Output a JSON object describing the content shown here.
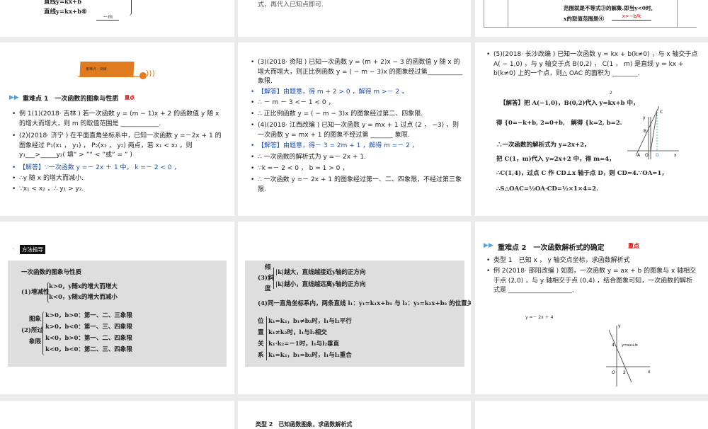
{
  "slides": {
    "s0a": {
      "line1": "直线y=kx+b",
      "line2": "直线y=kx+b⑥",
      "blank": "－m"
    },
    "s0b": {
      "text": "式，再代入已知点即可."
    },
    "s0c": {
      "line1": "范围就是不等式③的解集.即当y<0时,",
      "line2": "x的取值范围是④",
      "answer": "x>−b/k"
    },
    "s1": {
      "banner": "重难点 · 突破",
      "title": "重难点 1　一次函数的图象与性质",
      "tag": "重点",
      "bullets": [
        "例 1(1)(2018· 吉林 ) 若一次函数 y = (m − 1)x + 2 的函数值 y 随 x 的增大而增大，则 m 的取值范围是 ____________.",
        "(2)(2018· 济宁 ) 在平面直角坐标系中，已知一次函数 y =－2x + 1 的图象经过 P₁(x₁ ， y₁) ， P₂(x₂ ， y₂) 两点，若 x₁ < x₂ ，则 y₁___>_____y₂( 填“ > ”“ < ”或“ = ” )",
        "【解答】∵一次函数 y =－ 2x ＋ 1 中， k =－ 2 < 0 ，",
        "∴y 随 x 的增大而减小.",
        "∵x₁ < x₂ ，∴ y₁ > y₂."
      ]
    },
    "s2": {
      "bullets": [
        "(3)(2018· 资阳 ) 已知一次函数 y = (m + 2)x − 3 的函数值 y 随 x 的增大而增大，则正比例函数 y = ( − m − 3)x 的图象经过第___________ 象限.",
        "【解答】由题意，得 m + 2 > 0 ，解得 m >－ 2 ，",
        "∴ － m － 3 <－ 1 < 0 ，",
        "∴ 正比例函数 y = ( − m − 3)x 的图象经过第二、四象限.",
        "(4)(2018· 江西改编 ) 已知一次函数 y = mx + 1 过点 (2 ， −3) ，则一次函数 y = mx + 1 的图象不经过第 _______ 象限.",
        "【解答】由题意，得－ 3 = 2m + 1 ，解得 m =－ 2 ，",
        "∴ 一次函数的解析式为 y =－ 2x + 1.",
        "∵k =－ 2 < 0 ， b = 1 > 0 ，",
        "∴ 一次函数 y =－ 2x + 1 的图象经过第一、二、四象限，不经过第三象限."
      ]
    },
    "s3": {
      "bullet": "(5)(2018· 长沙改编 ) 已知一次函数 y = kx + b(k≠0) ，与 x 轴交于点 A( − 1,0) ，与 y 轴交于点 B(0,2) ， C(1 ， m) 是直线 y = kx + b(k≠0) 上的一个点，则△ OAC 的面积为 ________.",
      "answer": "2",
      "lines": [
        "【解答】把 A(−1,0)，B(0,2)代入 y=kx+b 中，",
        "得 {0=−k+b, 2=0+b,　解得 {k=2, b=2.",
        "∴一次函数的解析式为 y=2x+2，",
        "把 C(1，m)代入 y=2x+2 中，得 m=4，",
        "∴C(1,4)，过点 C 作 CD⊥x 轴于点 D，则 CD=4.∵OA=1，",
        "∴S△OAC=½OA·CD=½×1×4=2."
      ],
      "labels": {
        "y": "y",
        "x": "x",
        "A": "A",
        "O": "O",
        "D": "D",
        "B": "B",
        "C": "C"
      }
    },
    "s4": {
      "badge": "方法指导",
      "title": "一次函数的图象与性质",
      "p1_label": "(1)增减性",
      "p1": [
        "k>0，y随x的增大而增大",
        "k<0，y随x的增大而减小"
      ],
      "p2_label": [
        "图象",
        "(2)所过",
        "象限"
      ],
      "p2": [
        "k>0，b>0：第一、二、三象限",
        "k>0，b<0：第一、三、四象限",
        "k<0，b>0：第一、二、四象限",
        "k<0，b<0：第二、三、四象限"
      ]
    },
    "s5": {
      "p3_label": [
        "倾",
        "(3)斜",
        "度"
      ],
      "p3": [
        "|k|越大，直线越接近y轴的正方向",
        "|k|越小，直线越远离y轴的正方向"
      ],
      "p4": "(4)同一直角坐标系内，两条直线 l₁：y₁=k₁x+b₁ 与 l₂：y₂=k₂x+b₂ 的位置关系：",
      "p4_label": [
        "位",
        "置",
        "关",
        "系"
      ],
      "p4_items": [
        "k₁=k₂，b₁≠b₂时，l₁与l₂平行",
        "k₁≠k₂时，l₁与l₂相交",
        "k₁·k₂=－1时，l₁与l₂垂直",
        "k₁=k₂，b₁=b₂时，l₁与l₂重合"
      ]
    },
    "s6": {
      "title": "重难点 2　一次函数解析式的确定",
      "tag": "重点",
      "bullets": [
        "类型 1　已知 x ， y 轴交点坐标，求函数解析式",
        "例 2(2018· 邵阳改编 ) 如图，一次函数 y = ax + b 的图象与 x 轴相交于点 (2,0) ，与 y 轴相交于点 (0,4) ，结合图象可知，一次函数的解析式是 ____________________."
      ],
      "answer": "y =－ 2x ＋ 4",
      "labels": {
        "y": "y",
        "x": "x",
        "four": "4",
        "two": "2",
        "O": "O",
        "line": "y=ax+b"
      }
    },
    "s8": {
      "text": "类型 2　已知函数图象，求函数解析式"
    }
  },
  "colors": {
    "accent": "#e07b1f",
    "blue": "#1f4fa8",
    "red": "#dd0000",
    "panel": "#dedede"
  }
}
